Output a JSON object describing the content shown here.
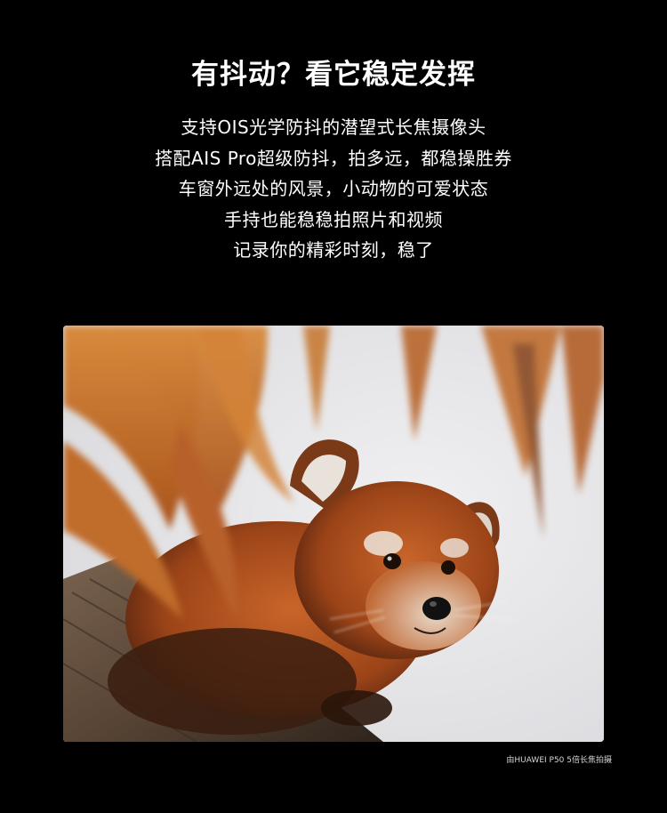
{
  "headline": "有抖动？看它稳定发挥",
  "body_lines": [
    "支持OIS光学防抖的潜望式长焦摄像头",
    "搭配AIS Pro超级防抖，拍多远，都稳操胜券",
    "车窗外远处的风景，小动物的可爱状态",
    "手持也能稳稳拍照片和视频",
    "记录你的精彩时刻，稳了"
  ],
  "caption": "由HUAWEI P50 5倍长焦拍摄",
  "colors": {
    "background": "#000000",
    "text": "#ffffff",
    "sky": "#e3e3e6",
    "fur": "#b5541f",
    "leaf": "#c8762c",
    "log": "#5a4636"
  }
}
